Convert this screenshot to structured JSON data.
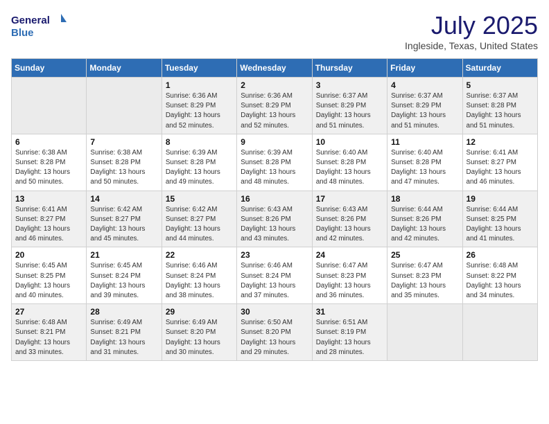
{
  "logo": {
    "line1": "General",
    "line2": "Blue"
  },
  "title": "July 2025",
  "location": "Ingleside, Texas, United States",
  "weekdays": [
    "Sunday",
    "Monday",
    "Tuesday",
    "Wednesday",
    "Thursday",
    "Friday",
    "Saturday"
  ],
  "weeks": [
    [
      {
        "day": "",
        "sunrise": "",
        "sunset": "",
        "daylight": ""
      },
      {
        "day": "",
        "sunrise": "",
        "sunset": "",
        "daylight": ""
      },
      {
        "day": "1",
        "sunrise": "Sunrise: 6:36 AM",
        "sunset": "Sunset: 8:29 PM",
        "daylight": "Daylight: 13 hours and 52 minutes."
      },
      {
        "day": "2",
        "sunrise": "Sunrise: 6:36 AM",
        "sunset": "Sunset: 8:29 PM",
        "daylight": "Daylight: 13 hours and 52 minutes."
      },
      {
        "day": "3",
        "sunrise": "Sunrise: 6:37 AM",
        "sunset": "Sunset: 8:29 PM",
        "daylight": "Daylight: 13 hours and 51 minutes."
      },
      {
        "day": "4",
        "sunrise": "Sunrise: 6:37 AM",
        "sunset": "Sunset: 8:29 PM",
        "daylight": "Daylight: 13 hours and 51 minutes."
      },
      {
        "day": "5",
        "sunrise": "Sunrise: 6:37 AM",
        "sunset": "Sunset: 8:28 PM",
        "daylight": "Daylight: 13 hours and 51 minutes."
      }
    ],
    [
      {
        "day": "6",
        "sunrise": "Sunrise: 6:38 AM",
        "sunset": "Sunset: 8:28 PM",
        "daylight": "Daylight: 13 hours and 50 minutes."
      },
      {
        "day": "7",
        "sunrise": "Sunrise: 6:38 AM",
        "sunset": "Sunset: 8:28 PM",
        "daylight": "Daylight: 13 hours and 50 minutes."
      },
      {
        "day": "8",
        "sunrise": "Sunrise: 6:39 AM",
        "sunset": "Sunset: 8:28 PM",
        "daylight": "Daylight: 13 hours and 49 minutes."
      },
      {
        "day": "9",
        "sunrise": "Sunrise: 6:39 AM",
        "sunset": "Sunset: 8:28 PM",
        "daylight": "Daylight: 13 hours and 48 minutes."
      },
      {
        "day": "10",
        "sunrise": "Sunrise: 6:40 AM",
        "sunset": "Sunset: 8:28 PM",
        "daylight": "Daylight: 13 hours and 48 minutes."
      },
      {
        "day": "11",
        "sunrise": "Sunrise: 6:40 AM",
        "sunset": "Sunset: 8:28 PM",
        "daylight": "Daylight: 13 hours and 47 minutes."
      },
      {
        "day": "12",
        "sunrise": "Sunrise: 6:41 AM",
        "sunset": "Sunset: 8:27 PM",
        "daylight": "Daylight: 13 hours and 46 minutes."
      }
    ],
    [
      {
        "day": "13",
        "sunrise": "Sunrise: 6:41 AM",
        "sunset": "Sunset: 8:27 PM",
        "daylight": "Daylight: 13 hours and 46 minutes."
      },
      {
        "day": "14",
        "sunrise": "Sunrise: 6:42 AM",
        "sunset": "Sunset: 8:27 PM",
        "daylight": "Daylight: 13 hours and 45 minutes."
      },
      {
        "day": "15",
        "sunrise": "Sunrise: 6:42 AM",
        "sunset": "Sunset: 8:27 PM",
        "daylight": "Daylight: 13 hours and 44 minutes."
      },
      {
        "day": "16",
        "sunrise": "Sunrise: 6:43 AM",
        "sunset": "Sunset: 8:26 PM",
        "daylight": "Daylight: 13 hours and 43 minutes."
      },
      {
        "day": "17",
        "sunrise": "Sunrise: 6:43 AM",
        "sunset": "Sunset: 8:26 PM",
        "daylight": "Daylight: 13 hours and 42 minutes."
      },
      {
        "day": "18",
        "sunrise": "Sunrise: 6:44 AM",
        "sunset": "Sunset: 8:26 PM",
        "daylight": "Daylight: 13 hours and 42 minutes."
      },
      {
        "day": "19",
        "sunrise": "Sunrise: 6:44 AM",
        "sunset": "Sunset: 8:25 PM",
        "daylight": "Daylight: 13 hours and 41 minutes."
      }
    ],
    [
      {
        "day": "20",
        "sunrise": "Sunrise: 6:45 AM",
        "sunset": "Sunset: 8:25 PM",
        "daylight": "Daylight: 13 hours and 40 minutes."
      },
      {
        "day": "21",
        "sunrise": "Sunrise: 6:45 AM",
        "sunset": "Sunset: 8:24 PM",
        "daylight": "Daylight: 13 hours and 39 minutes."
      },
      {
        "day": "22",
        "sunrise": "Sunrise: 6:46 AM",
        "sunset": "Sunset: 8:24 PM",
        "daylight": "Daylight: 13 hours and 38 minutes."
      },
      {
        "day": "23",
        "sunrise": "Sunrise: 6:46 AM",
        "sunset": "Sunset: 8:24 PM",
        "daylight": "Daylight: 13 hours and 37 minutes."
      },
      {
        "day": "24",
        "sunrise": "Sunrise: 6:47 AM",
        "sunset": "Sunset: 8:23 PM",
        "daylight": "Daylight: 13 hours and 36 minutes."
      },
      {
        "day": "25",
        "sunrise": "Sunrise: 6:47 AM",
        "sunset": "Sunset: 8:23 PM",
        "daylight": "Daylight: 13 hours and 35 minutes."
      },
      {
        "day": "26",
        "sunrise": "Sunrise: 6:48 AM",
        "sunset": "Sunset: 8:22 PM",
        "daylight": "Daylight: 13 hours and 34 minutes."
      }
    ],
    [
      {
        "day": "27",
        "sunrise": "Sunrise: 6:48 AM",
        "sunset": "Sunset: 8:21 PM",
        "daylight": "Daylight: 13 hours and 33 minutes."
      },
      {
        "day": "28",
        "sunrise": "Sunrise: 6:49 AM",
        "sunset": "Sunset: 8:21 PM",
        "daylight": "Daylight: 13 hours and 31 minutes."
      },
      {
        "day": "29",
        "sunrise": "Sunrise: 6:49 AM",
        "sunset": "Sunset: 8:20 PM",
        "daylight": "Daylight: 13 hours and 30 minutes."
      },
      {
        "day": "30",
        "sunrise": "Sunrise: 6:50 AM",
        "sunset": "Sunset: 8:20 PM",
        "daylight": "Daylight: 13 hours and 29 minutes."
      },
      {
        "day": "31",
        "sunrise": "Sunrise: 6:51 AM",
        "sunset": "Sunset: 8:19 PM",
        "daylight": "Daylight: 13 hours and 28 minutes."
      },
      {
        "day": "",
        "sunrise": "",
        "sunset": "",
        "daylight": ""
      },
      {
        "day": "",
        "sunrise": "",
        "sunset": "",
        "daylight": ""
      }
    ]
  ]
}
